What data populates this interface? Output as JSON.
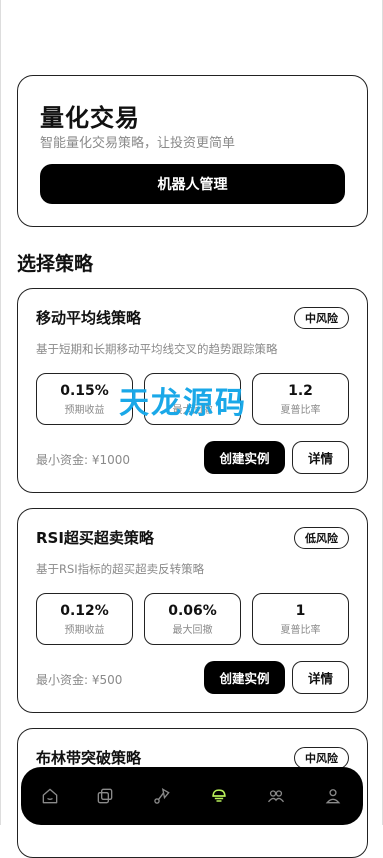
{
  "hero": {
    "title": "量化交易",
    "subtitle": "智能量化交易策略，让投资更简单",
    "button_label": "机器人管理"
  },
  "section_title": "选择策略",
  "strategies": [
    {
      "name": "移动平均线策略",
      "risk": "中风险",
      "description": "基于短期和长期移动平均线交叉的趋势跟踪策略",
      "metrics": [
        {
          "value": "0.15%",
          "label": "预期收益"
        },
        {
          "value": "",
          "label": "最大回撤"
        },
        {
          "value": "1.2",
          "label": "夏普比率"
        }
      ],
      "min_fund": "最小资金: ¥1000",
      "create_label": "创建实例",
      "detail_label": "详情"
    },
    {
      "name": "RSI超买超卖策略",
      "risk": "低风险",
      "description": "基于RSI指标的超买超卖反转策略",
      "metrics": [
        {
          "value": "0.12%",
          "label": "预期收益"
        },
        {
          "value": "0.06%",
          "label": "最大回撤"
        },
        {
          "value": "1",
          "label": "夏普比率"
        }
      ],
      "min_fund": "最小资金: ¥500",
      "create_label": "创建实例",
      "detail_label": "详情"
    },
    {
      "name": "布林带突破策略",
      "risk": "中风险"
    }
  ],
  "watermark": "天龙源码",
  "tabbar": {
    "items": [
      {
        "icon": "home-icon"
      },
      {
        "icon": "copy-icon"
      },
      {
        "icon": "route-icon"
      },
      {
        "icon": "robot-icon",
        "active": true
      },
      {
        "icon": "users-icon"
      },
      {
        "icon": "profile-icon"
      }
    ],
    "active_color": "#b8f05a"
  }
}
